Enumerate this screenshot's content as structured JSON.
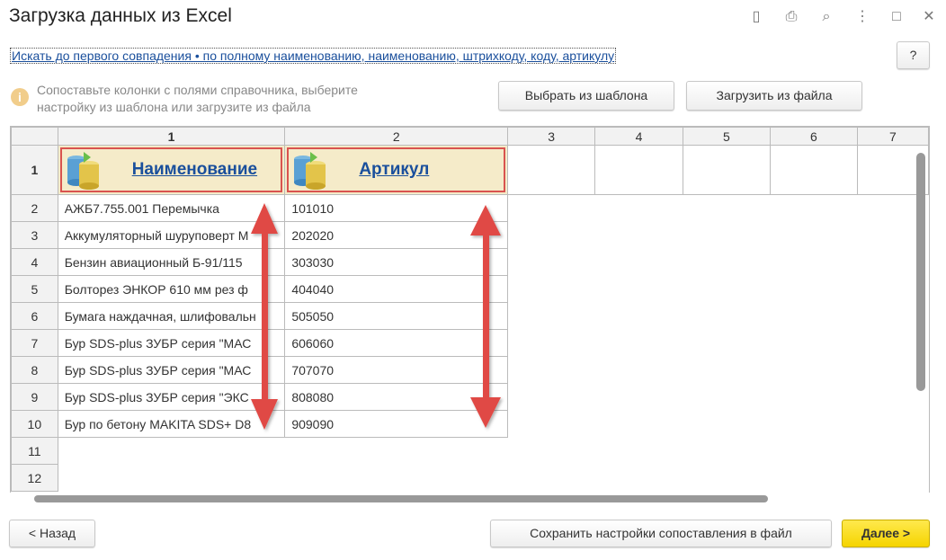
{
  "window": {
    "title": "Загрузка данных из Excel",
    "icons": [
      "save-icon",
      "print-icon",
      "preview-icon",
      "more-icon",
      "maximize-icon",
      "close-icon"
    ]
  },
  "search_link": "Искать до первого совпадения • по полному наименованию, наименованию, штрихкоду, коду, артикулу",
  "help_label": "?",
  "hint": {
    "line1": "Сопоставьте колонки с полями справочника, выберите",
    "line2": "настройку из шаблона или загрузите из файла"
  },
  "buttons": {
    "template": "Выбрать из шаблона",
    "load_file": "Загрузить из файла",
    "back": "< Назад",
    "save_settings": "Сохранить настройки сопоставления в файл",
    "next": "Далее >"
  },
  "grid": {
    "col_headers": [
      "1",
      "2",
      "3",
      "4",
      "5",
      "6",
      "7"
    ],
    "header_row": {
      "num": "1",
      "fields": [
        "Наименование",
        "Артикул"
      ]
    },
    "rows": [
      {
        "num": "2",
        "name": "АЖБ7.755.001 Перемычка",
        "sku": "101010"
      },
      {
        "num": "3",
        "name": "Аккумуляторный шуруповерт M",
        "sku": "202020"
      },
      {
        "num": "4",
        "name": "Бензин авиационный Б-91/115",
        "sku": "303030"
      },
      {
        "num": "5",
        "name": "Болторез ЭНКОР 610 мм рез ф",
        "sku": "404040"
      },
      {
        "num": "6",
        "name": "Бумага наждачная, шлифовальн",
        "sku": "505050"
      },
      {
        "num": "7",
        "name": "Бур SDS-plus ЗУБР серия \"МАС",
        "sku": "606060"
      },
      {
        "num": "8",
        "name": "Бур SDS-plus ЗУБР серия \"МАС",
        "sku": "707070"
      },
      {
        "num": "9",
        "name": "Бур SDS-plus ЗУБР серия \"ЭКС",
        "sku": "808080"
      },
      {
        "num": "10",
        "name": "Бур по бетону MAKITA SDS+ D8",
        "sku": "909090"
      }
    ],
    "empty_rows": [
      "11",
      "12"
    ]
  },
  "colors": {
    "accent": "#f5d400",
    "annotation": "#e04a45",
    "link": "#1a4f9c"
  }
}
